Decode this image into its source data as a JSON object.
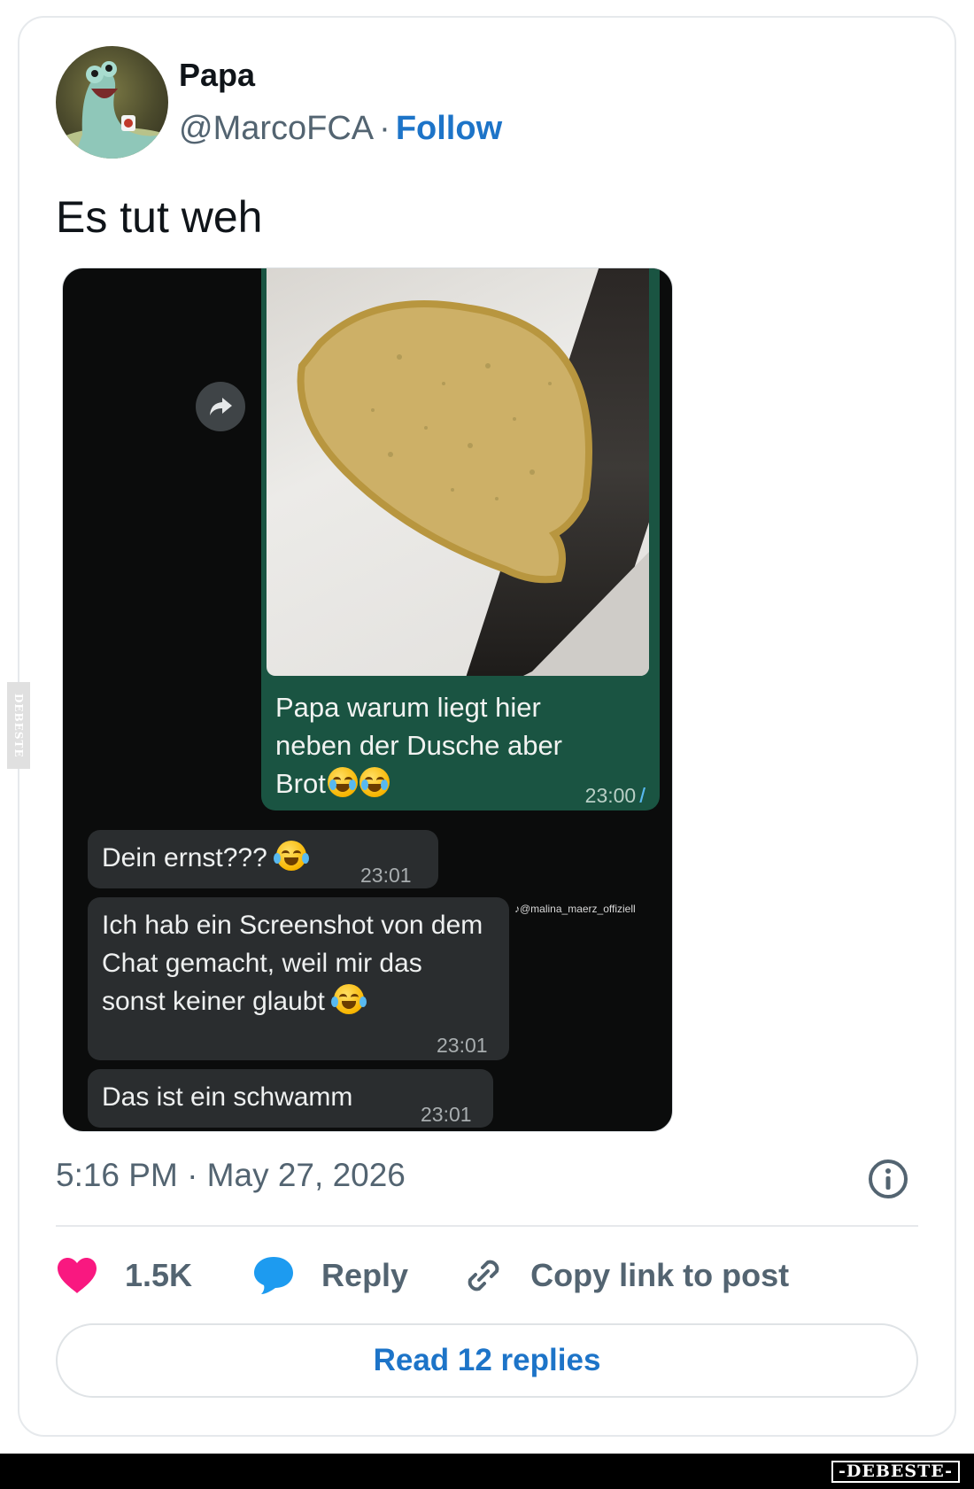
{
  "author": {
    "name": "Papa",
    "handle": "@MarcoFCA",
    "separator": "·",
    "follow_label": "Follow"
  },
  "tweet": {
    "text": "Es tut weh",
    "timestamp": "5:16 PM · May 27, 2026"
  },
  "chat": {
    "outgoing": {
      "text": "Papa warum liegt hier neben der Dusche aber Brot",
      "emoji_count": 2,
      "time": "23:00"
    },
    "incoming": [
      {
        "text": "Dein ernst???",
        "time": "23:01",
        "emoji": "laughing-tears-emoji"
      },
      {
        "text": "Ich hab ein Screenshot von dem Chat gemacht, weil mir das sonst keiner glaubt",
        "time": "23:01",
        "emoji": "laughing-tears-emoji"
      },
      {
        "text": "Das ist ein schwamm",
        "time": "23:01"
      }
    ],
    "watermark": "@malina_maerz_offiziell"
  },
  "actions": {
    "like_count": "1.5K",
    "reply_label": "Reply",
    "copy_label": "Copy link to post",
    "read_replies_label": "Read 12 replies"
  },
  "colors": {
    "accent": "#1d74c8",
    "like": "#f91880",
    "reply": "#1d9bf0",
    "chat_out": "#1a5442",
    "chat_in": "#2a2d2f"
  },
  "branding": {
    "side": "DEBESTE",
    "bottom": "-DEBESTE-"
  }
}
